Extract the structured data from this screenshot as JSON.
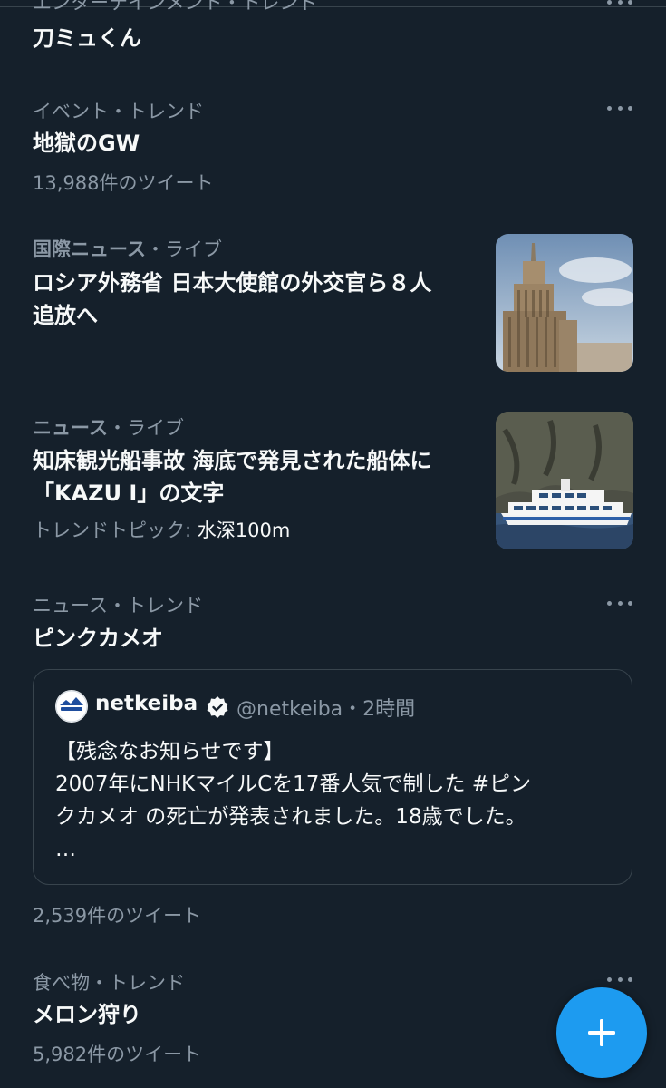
{
  "items": [
    {
      "category": "エンターテインメント・トレンド",
      "title": "刀ミュくん"
    },
    {
      "category": "イベント・トレンド",
      "title": "地獄のGW",
      "tweets": "13,988件のツイート"
    },
    {
      "category": "国際ニュース",
      "category_suffix": "・ライブ",
      "title_lines": [
        "ロシア外務省 日本大使館の外交官ら８人",
        "追放へ"
      ],
      "image_icon": "kremlin-building-photo"
    },
    {
      "category": "ニュース",
      "category_suffix": "・ライブ",
      "title_lines": [
        "知床観光船事故 海底で発見された船体に",
        "「KAZU I」の文字"
      ],
      "trend_label": "トレンドトピック:",
      "trend_value": "水深100m",
      "image_icon": "ferry-boat-photo"
    },
    {
      "category": "ニュース・トレンド",
      "title": "ピンクカメオ",
      "tweets": "2,539件のツイート"
    },
    {
      "category": "食べ物・トレンド",
      "title": "メロン狩り",
      "tweets": "5,982件のツイート"
    }
  ],
  "quoted_tweet": {
    "name": "netkeiba",
    "handle": "@netkeiba",
    "time": "・2時間",
    "text_lines": [
      "【残念なお知らせです】",
      "2007年にNHKマイルCを17番人気で制した #ピン",
      "クカメオ の死亡が発表されました。18歳でした。",
      "…"
    ]
  },
  "icons": {
    "more": "more-horizontal-icon",
    "verified": "verified-badge-icon",
    "compose": "plus-icon"
  },
  "colors": {
    "background": "#15202b",
    "accent": "#1d9bf0",
    "secondary_text": "#8b98a5",
    "border": "#38444d"
  }
}
